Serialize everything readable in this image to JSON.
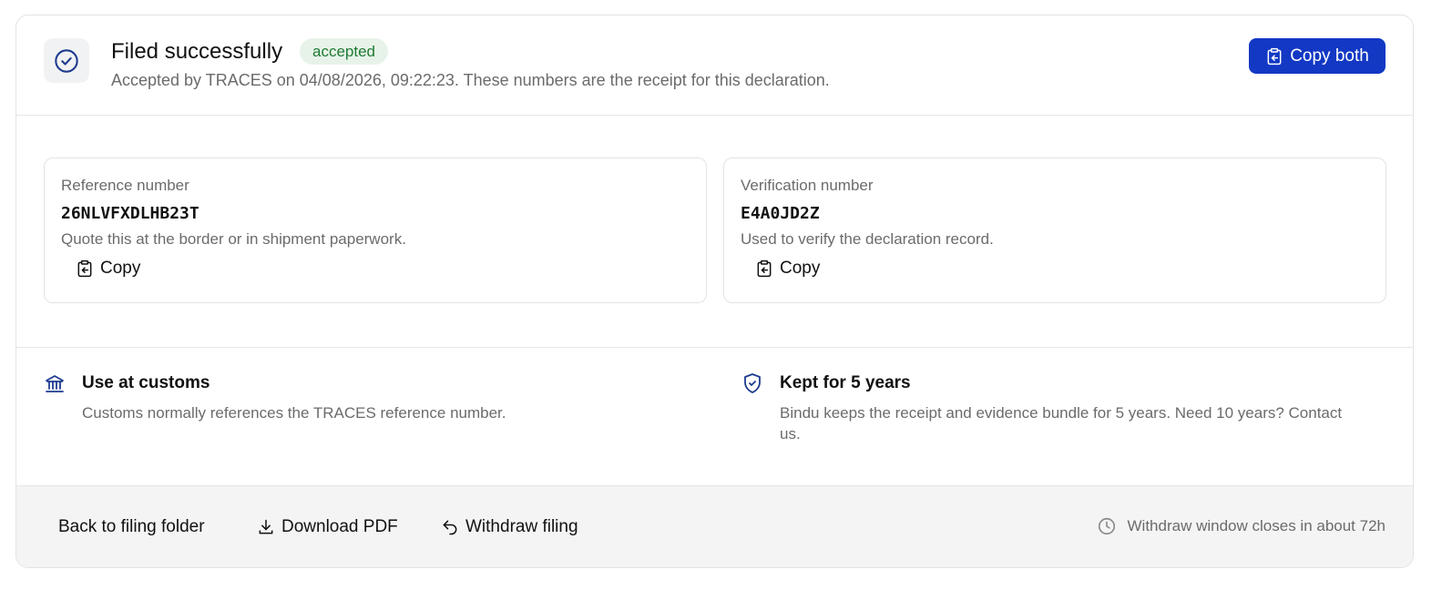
{
  "header": {
    "title": "Filed successfully",
    "badge": "accepted",
    "subtitle": "Accepted by TRACES on 04/08/2026, 09:22:23. These numbers are the receipt for this declaration.",
    "copy_both_label": "Copy both",
    "status_icon": "check-circle-icon"
  },
  "numbers": [
    {
      "label": "Reference number",
      "value": "26NLVFXDLHB23T",
      "description": "Quote this at the border or in shipment paperwork.",
      "copy_label": "Copy"
    },
    {
      "label": "Verification number",
      "value": "E4A0JD2Z",
      "description": "Used to verify the declaration record.",
      "copy_label": "Copy"
    }
  ],
  "info": [
    {
      "icon": "bank-icon",
      "title": "Use at customs",
      "text": "Customs normally references the TRACES reference number."
    },
    {
      "icon": "shield-check-icon",
      "title": "Kept for 5 years",
      "text": "Bindu keeps the receipt and evidence bundle for 5 years. Need 10 years? Contact us."
    }
  ],
  "footer": {
    "back_label": "Back to filing folder",
    "download_label": "Download PDF",
    "withdraw_label": "Withdraw filing",
    "window_note": "Withdraw window closes in about 72h"
  },
  "colors": {
    "primary": "#1238c4",
    "badge_bg": "#e7f3e8",
    "badge_text": "#1f7a34",
    "icon_accent": "#1d3b8f",
    "muted_text": "#6b6b6b"
  }
}
